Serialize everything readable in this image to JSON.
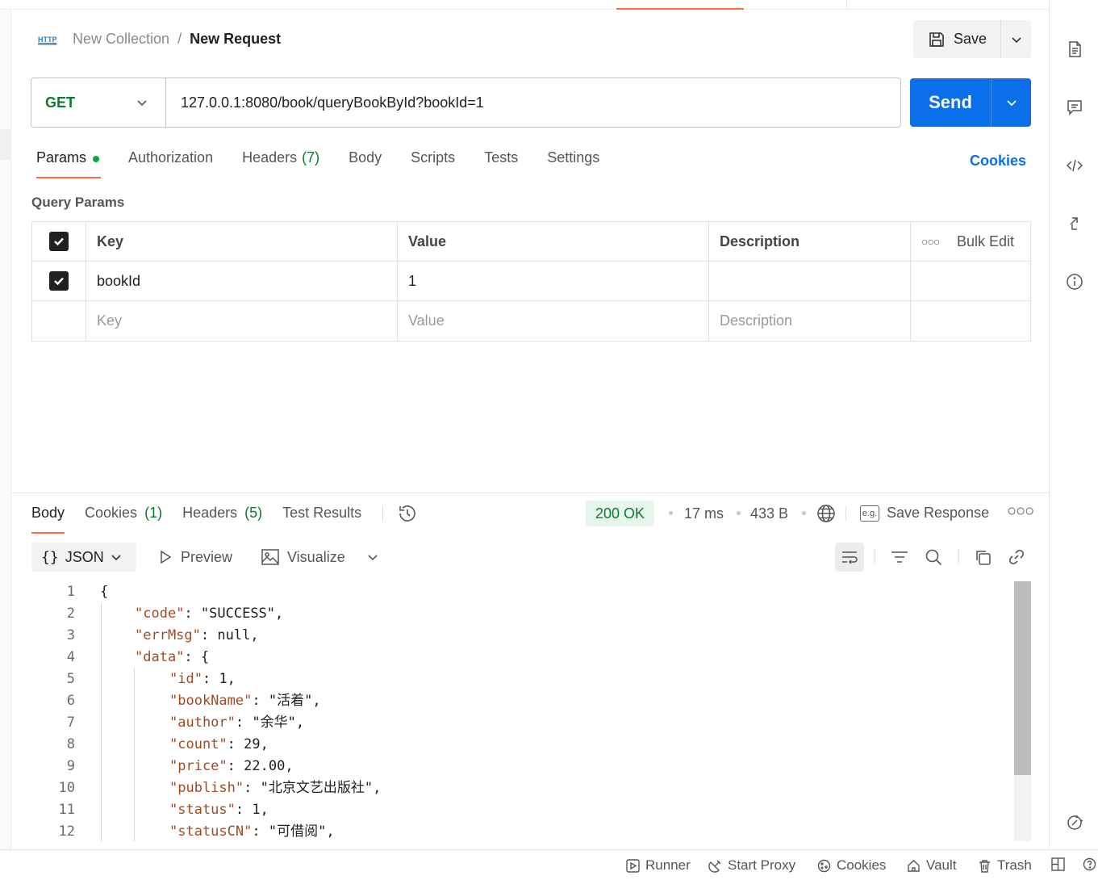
{
  "header": {
    "protocol_icon": "http-icon",
    "collection": "New Collection",
    "separator": "/",
    "request_name": "New Request",
    "save_label": "Save"
  },
  "request": {
    "method": "GET",
    "url": "127.0.0.1:8080/book/queryBookById?bookId=1",
    "send_label": "Send"
  },
  "tabs": {
    "params": "Params",
    "authorization": "Authorization",
    "headers": "Headers",
    "headers_count": "(7)",
    "body": "Body",
    "scripts": "Scripts",
    "tests": "Tests",
    "settings": "Settings",
    "cookies": "Cookies"
  },
  "query_params": {
    "title": "Query Params",
    "columns": {
      "key": "Key",
      "value": "Value",
      "description": "Description",
      "bulk_edit": "Bulk Edit"
    },
    "rows": [
      {
        "checked": true,
        "key": "bookId",
        "value": "1",
        "description": ""
      }
    ],
    "placeholder": {
      "key": "Key",
      "value": "Value",
      "description": "Description"
    }
  },
  "response": {
    "tabs": {
      "body": "Body",
      "cookies": "Cookies",
      "cookies_count": "(1)",
      "headers": "Headers",
      "headers_count": "(5)",
      "test_results": "Test Results"
    },
    "status": "200 OK",
    "time": "17 ms",
    "size": "433 B",
    "save_response": "Save Response",
    "eg_badge": "e.g.",
    "format": "JSON",
    "preview": "Preview",
    "visualize": "Visualize",
    "lines": [
      {
        "n": "1",
        "t": "{"
      },
      {
        "n": "2",
        "t": "\"code\": \"SUCCESS\","
      },
      {
        "n": "3",
        "t": "\"errMsg\": null,"
      },
      {
        "n": "4",
        "t": "\"data\": {"
      },
      {
        "n": "5",
        "t": "\"id\": 1,"
      },
      {
        "n": "6",
        "t": "\"bookName\": \"活着\","
      },
      {
        "n": "7",
        "t": "\"author\": \"余华\","
      },
      {
        "n": "8",
        "t": "\"count\": 29,"
      },
      {
        "n": "9",
        "t": "\"price\": 22.00,"
      },
      {
        "n": "10",
        "t": "\"publish\": \"北京文艺出版社\","
      },
      {
        "n": "11",
        "t": "\"status\": 1,"
      },
      {
        "n": "12",
        "t": "\"statusCN\": \"可借阅\","
      }
    ]
  },
  "footer": {
    "runner": "Runner",
    "start_proxy": "Start Proxy",
    "cookies": "Cookies",
    "vault": "Vault",
    "trash": "Trash"
  },
  "colors": {
    "accent": "#ff6c37",
    "send": "#0a6fe8",
    "method_get": "#0b7a2f",
    "status_ok_bg": "#e6f6ec"
  }
}
